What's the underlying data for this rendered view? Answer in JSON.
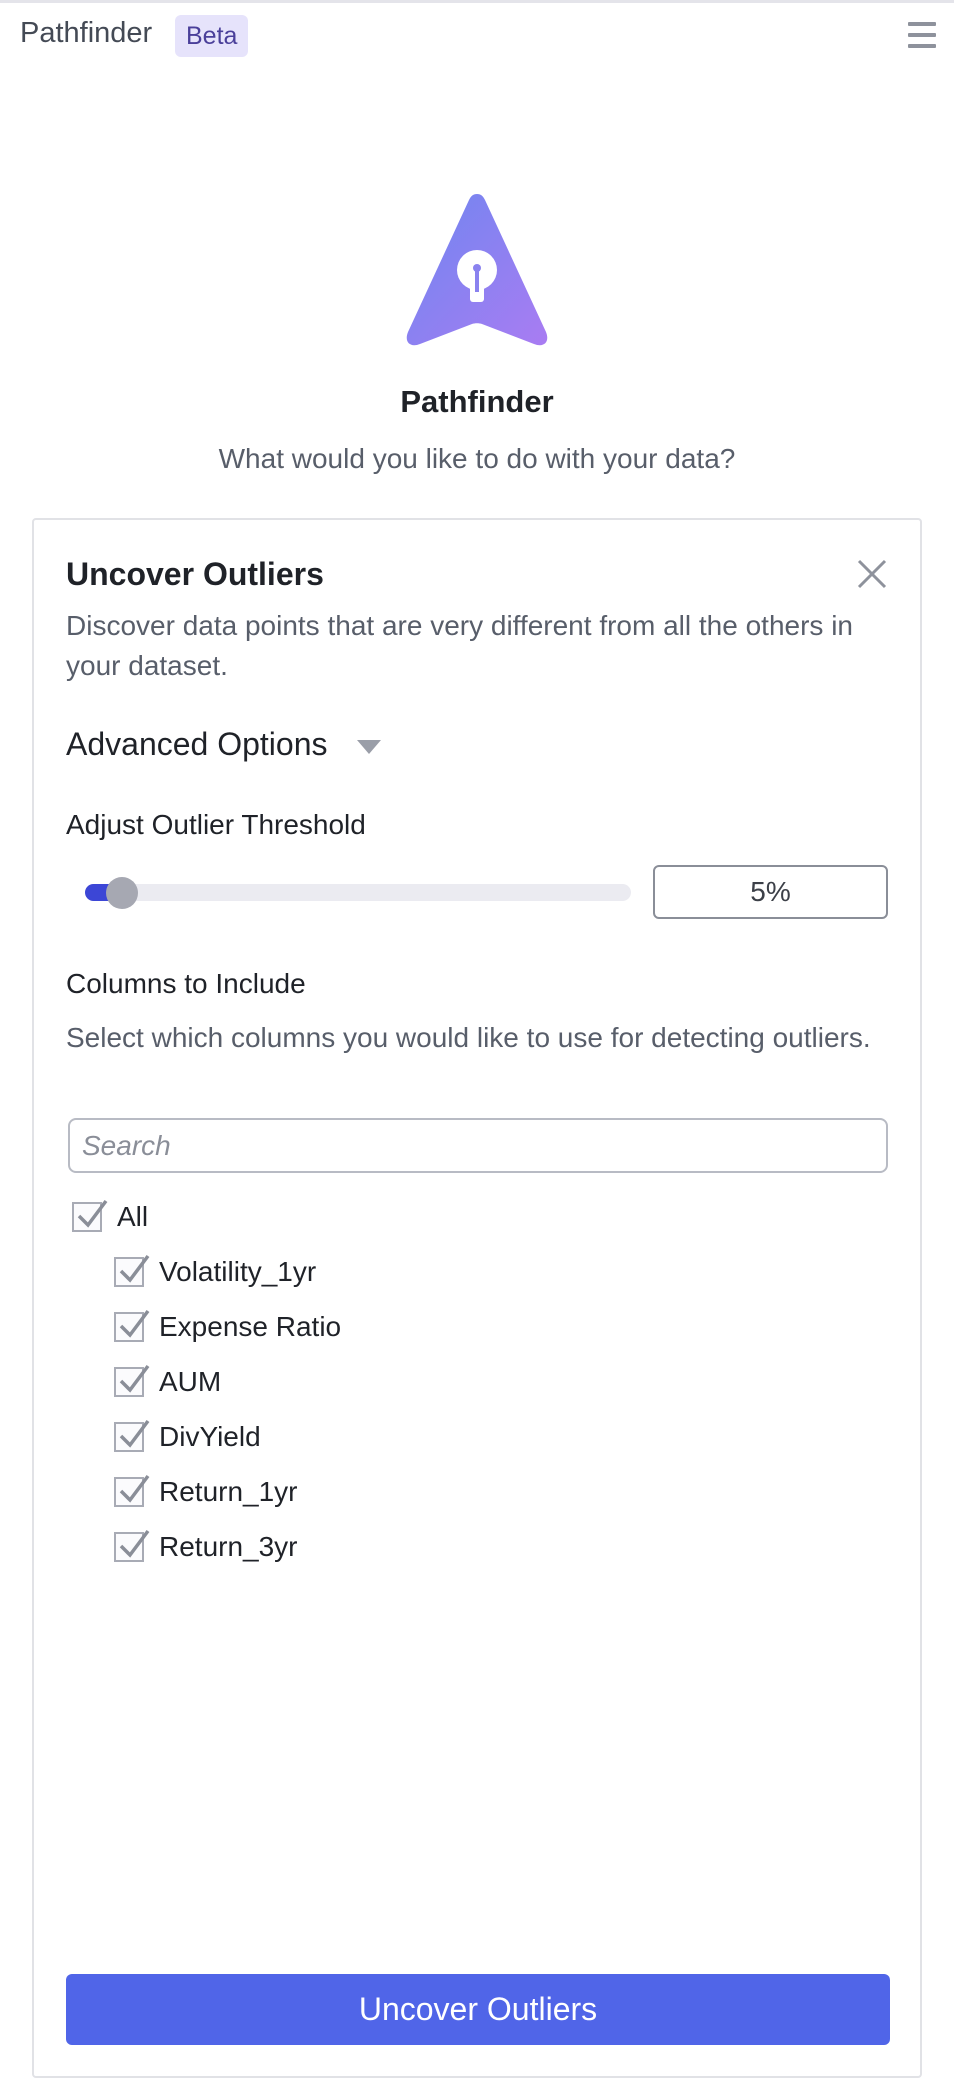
{
  "header": {
    "app_name": "Pathfinder",
    "badge": "Beta",
    "menu_icon": "hamburger-menu-icon"
  },
  "hero": {
    "logo_icon": "lightbulb-arrow-logo",
    "title": "Pathfinder",
    "subtitle": "What would you like to do with your data?"
  },
  "card": {
    "title": "Uncover Outliers",
    "description": "Discover data points that are very different from all the others in your dataset.",
    "close_icon": "close-icon",
    "advanced_options_label": "Advanced Options",
    "threshold": {
      "label": "Adjust Outlier Threshold",
      "value_text": "5%",
      "value": 5
    },
    "columns": {
      "label": "Columns to Include",
      "description": "Select which columns you would like to use for detecting outliers.",
      "search_placeholder": "Search",
      "all_label": "All",
      "all_checked": true,
      "items": [
        {
          "label": "Volatility_1yr",
          "checked": true
        },
        {
          "label": "Expense Ratio",
          "checked": true
        },
        {
          "label": "AUM",
          "checked": true
        },
        {
          "label": "DivYield",
          "checked": true
        },
        {
          "label": "Return_1yr",
          "checked": true
        },
        {
          "label": "Return_3yr",
          "checked": true
        }
      ]
    },
    "submit_label": "Uncover Outliers"
  },
  "colors": {
    "accent": "#5065e8",
    "slider_fill": "#3c46d6",
    "badge_bg": "#e6e3fb",
    "badge_text": "#4a3f9a"
  }
}
